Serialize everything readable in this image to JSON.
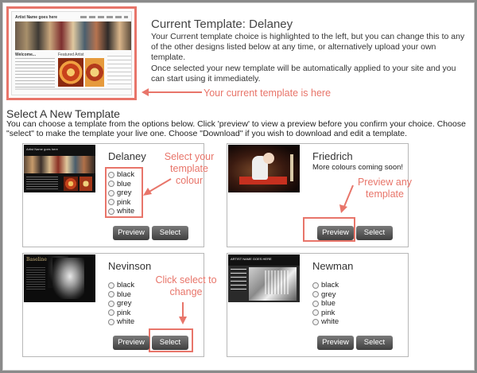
{
  "current": {
    "thumbnail": {
      "header": "Artist Name goes here",
      "welcome": "Welcome...",
      "featured": "Featured Artist"
    },
    "title": "Current Template: Delaney",
    "desc1": "Your Current template choice is highlighted to the left, but you can change this to any of the other designs listed below at any time, or alternatively upload your own template.",
    "desc2": "Once selected your new template will be automatically applied to your site and you can start using it immediately."
  },
  "annotations": {
    "current_here": "Your current template is here",
    "select_colour": "Select your template colour",
    "preview_any": "Preview any template",
    "click_select": "Click select to change"
  },
  "select_section": {
    "title": "Select A New Template",
    "desc": "You can choose a template from the options below. Click 'preview' to view a preview before you confirm your choice. Choose \"select\" to make the template your live one. Choose \"Download\" if you wish to download and edit a template."
  },
  "buttons": {
    "preview": "Preview",
    "select": "Select"
  },
  "templates": [
    {
      "name": "Delaney",
      "thumb_header": "Artist Name goes here",
      "colours": [
        "black",
        "blue",
        "grey",
        "pink",
        "white"
      ]
    },
    {
      "name": "Friedrich",
      "note": "More colours coming soon!"
    },
    {
      "name": "Nevinson",
      "thumb_logo": "Baseline",
      "colours": [
        "black",
        "blue",
        "grey",
        "pink",
        "white"
      ]
    },
    {
      "name": "Newman",
      "thumb_header": "ARTIST NAME GOES HERE",
      "colours": [
        "black",
        "grey",
        "blue",
        "pink",
        "white"
      ]
    }
  ],
  "colors": {
    "accent": "#e8756a",
    "button": "#4a4a4a",
    "border": "#b8b8b8"
  }
}
